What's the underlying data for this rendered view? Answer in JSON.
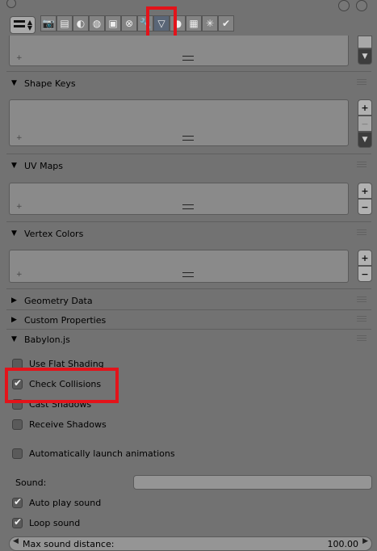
{
  "sections": {
    "shape_keys": "Shape Keys",
    "uv_maps": "UV Maps",
    "vertex_colors": "Vertex Colors",
    "geometry_data": "Geometry Data",
    "custom_properties": "Custom Properties",
    "babylonjs": "Babylon.js"
  },
  "babylon": {
    "use_flat_shading": "Use Flat Shading",
    "check_collisions": "Check Collisions",
    "cast_shadows": "Cast Shadows",
    "receive_shadows": "Receive Shadows",
    "auto_launch_animations": "Automatically launch animations",
    "sound_label": "Sound:",
    "sound_value": "",
    "auto_play_sound": "Auto play sound",
    "loop_sound": "Loop sound",
    "max_sound_distance_label": "Max sound distance:",
    "max_sound_distance_value": "100.00"
  },
  "checkbox_states": {
    "use_flat_shading": false,
    "check_collisions": true,
    "cast_shadows": false,
    "receive_shadows": false,
    "auto_launch_animations": false,
    "auto_play_sound": true,
    "loop_sound": true
  },
  "icons": [
    "render-icon",
    "scene-icon",
    "world-icon",
    "object-icon",
    "constraints-icon",
    "modifiers-icon",
    "data-icon",
    "material-icon",
    "texture-icon",
    "particles-icon",
    "physics-icon"
  ],
  "list_controls": {
    "add": "+",
    "remove": "−"
  },
  "colors": {
    "highlight_box": "#e3131a",
    "panel_bg": "#727272"
  }
}
